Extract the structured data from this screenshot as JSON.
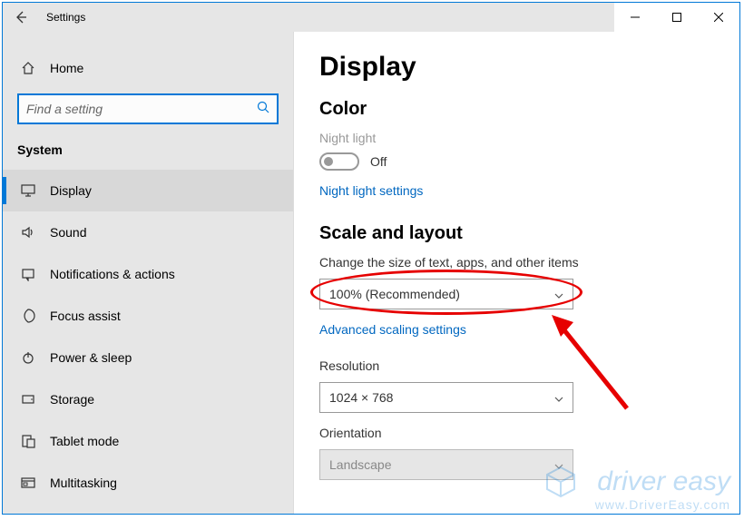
{
  "titlebar": {
    "title": "Settings"
  },
  "home": {
    "label": "Home"
  },
  "search": {
    "placeholder": "Find a setting"
  },
  "section_label": "System",
  "nav": [
    {
      "key": "display",
      "label": "Display",
      "active": true
    },
    {
      "key": "sound",
      "label": "Sound"
    },
    {
      "key": "notifications",
      "label": "Notifications & actions"
    },
    {
      "key": "focus-assist",
      "label": "Focus assist"
    },
    {
      "key": "power-sleep",
      "label": "Power & sleep"
    },
    {
      "key": "storage",
      "label": "Storage"
    },
    {
      "key": "tablet-mode",
      "label": "Tablet mode"
    },
    {
      "key": "multitasking",
      "label": "Multitasking"
    }
  ],
  "main": {
    "page_title": "Display",
    "color_heading": "Color",
    "night_light_label": "Night light",
    "night_light_state": "Off",
    "night_light_link": "Night light settings",
    "scale_heading": "Scale and layout",
    "scale_label": "Change the size of text, apps, and other items",
    "scale_value": "100% (Recommended)",
    "advanced_scaling_link": "Advanced scaling settings",
    "resolution_label": "Resolution",
    "resolution_value": "1024 × 768",
    "orientation_label": "Orientation",
    "orientation_value": "Landscape"
  },
  "watermark": {
    "line1": "driver easy",
    "line2": "www.DriverEasy.com"
  }
}
